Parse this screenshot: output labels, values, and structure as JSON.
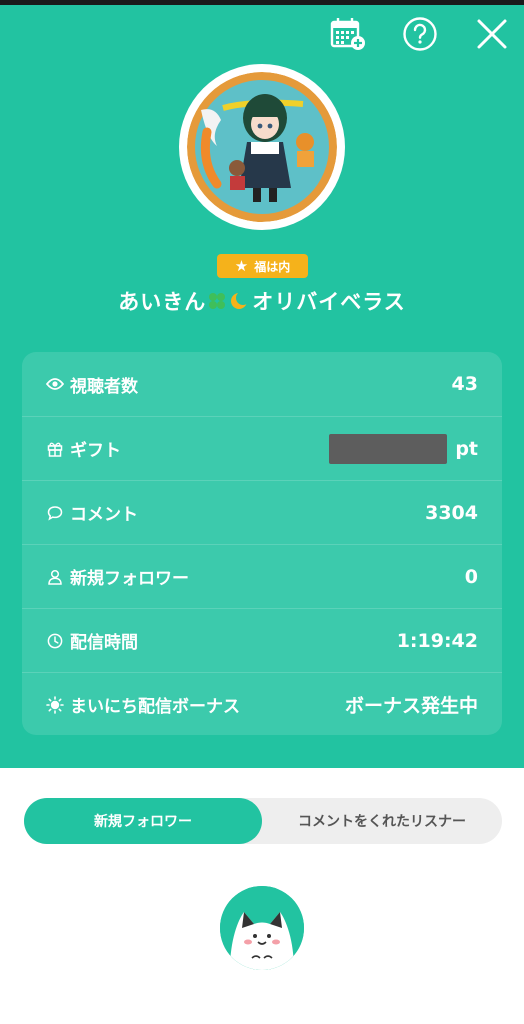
{
  "header": {
    "icons": [
      "calendar-add-icon",
      "help-icon",
      "close-icon"
    ]
  },
  "profile": {
    "badge_label": "福は内",
    "username_prefix": "あいきん",
    "username_suffix": "オリバイベラス"
  },
  "stats": [
    {
      "icon": "eye-icon",
      "label": "視聴者数",
      "value": "43"
    },
    {
      "icon": "gift-icon",
      "label": "ギフト",
      "value": "",
      "unit": "pt"
    },
    {
      "icon": "comment-icon",
      "label": "コメント",
      "value": "3304"
    },
    {
      "icon": "person-icon",
      "label": "新規フォロワー",
      "value": "0"
    },
    {
      "icon": "clock-icon",
      "label": "配信時間",
      "value": "1:19:42"
    },
    {
      "icon": "sun-icon",
      "label": "まいにち配信ボーナス",
      "value": "ボーナス発生中"
    }
  ],
  "tabs": [
    {
      "label": "新規フォロワー",
      "active": true
    },
    {
      "label": "コメントをくれたリスナー",
      "active": false
    }
  ],
  "colors": {
    "accent": "#22c3a1",
    "badge": "#f5b21b"
  }
}
